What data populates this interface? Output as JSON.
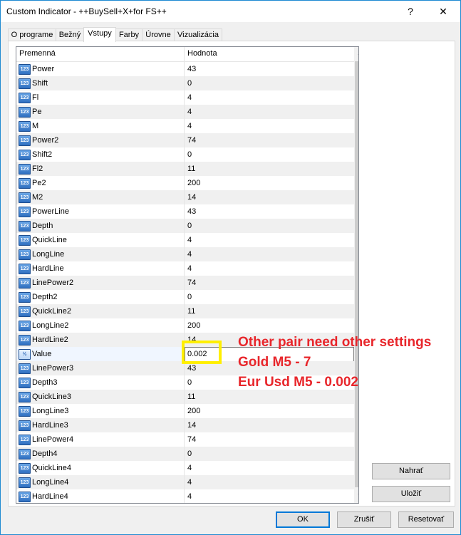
{
  "window": {
    "title": "Custom Indicator - ++BuySell+X+for FS++",
    "help_glyph": "?",
    "close_glyph": "✕"
  },
  "tabs": [
    {
      "label": "O programe"
    },
    {
      "label": "Bežný"
    },
    {
      "label": "Vstupy",
      "active": true
    },
    {
      "label": "Farby"
    },
    {
      "label": "Úrovne"
    },
    {
      "label": "Vizualizácia"
    }
  ],
  "grid": {
    "headers": {
      "name": "Premenná",
      "value": "Hodnota"
    },
    "rows": [
      {
        "name": "Power",
        "value": "43"
      },
      {
        "name": "Shift",
        "value": "0"
      },
      {
        "name": "Fl",
        "value": "4"
      },
      {
        "name": "Pe",
        "value": "4"
      },
      {
        "name": "M",
        "value": "4"
      },
      {
        "name": "Power2",
        "value": "74"
      },
      {
        "name": "Shift2",
        "value": "0"
      },
      {
        "name": "Fl2",
        "value": "11"
      },
      {
        "name": "Pe2",
        "value": "200"
      },
      {
        "name": "M2",
        "value": "14"
      },
      {
        "name": "PowerLine",
        "value": "43"
      },
      {
        "name": "Depth",
        "value": "0"
      },
      {
        "name": "QuickLine",
        "value": "4"
      },
      {
        "name": "LongLine",
        "value": "4"
      },
      {
        "name": "HardLine",
        "value": "4"
      },
      {
        "name": "LinePower2",
        "value": "74"
      },
      {
        "name": "Depth2",
        "value": "0"
      },
      {
        "name": "QuickLine2",
        "value": "11"
      },
      {
        "name": "LongLine2",
        "value": "200"
      },
      {
        "name": "HardLine2",
        "value": "14"
      },
      {
        "name": "Value",
        "value": "0.002",
        "editing": true
      },
      {
        "name": "LinePower3",
        "value": "43"
      },
      {
        "name": "Depth3",
        "value": "0"
      },
      {
        "name": "QuickLine3",
        "value": "11"
      },
      {
        "name": "LongLine3",
        "value": "200"
      },
      {
        "name": "HardLine3",
        "value": "14"
      },
      {
        "name": "LinePower4",
        "value": "74"
      },
      {
        "name": "Depth4",
        "value": "0"
      },
      {
        "name": "QuickLine4",
        "value": "4"
      },
      {
        "name": "LongLine4",
        "value": "4"
      },
      {
        "name": "HardLine4",
        "value": "4"
      }
    ],
    "icon_int": "123",
    "icon_double": "½"
  },
  "scroll": {
    "up": "▲",
    "down": "▼"
  },
  "side_buttons": {
    "load": "Nahrať",
    "save": "Uložiť"
  },
  "footer_buttons": {
    "ok": "OK",
    "cancel": "Zrušiť",
    "reset": "Resetovať"
  },
  "annotation": {
    "line1": "Other pair need other settings",
    "line2": "Gold M5 - 7",
    "line3": "Eur Usd M5 - 0.002",
    "color": "#e8262b",
    "highlight_color": "#ffef00"
  }
}
